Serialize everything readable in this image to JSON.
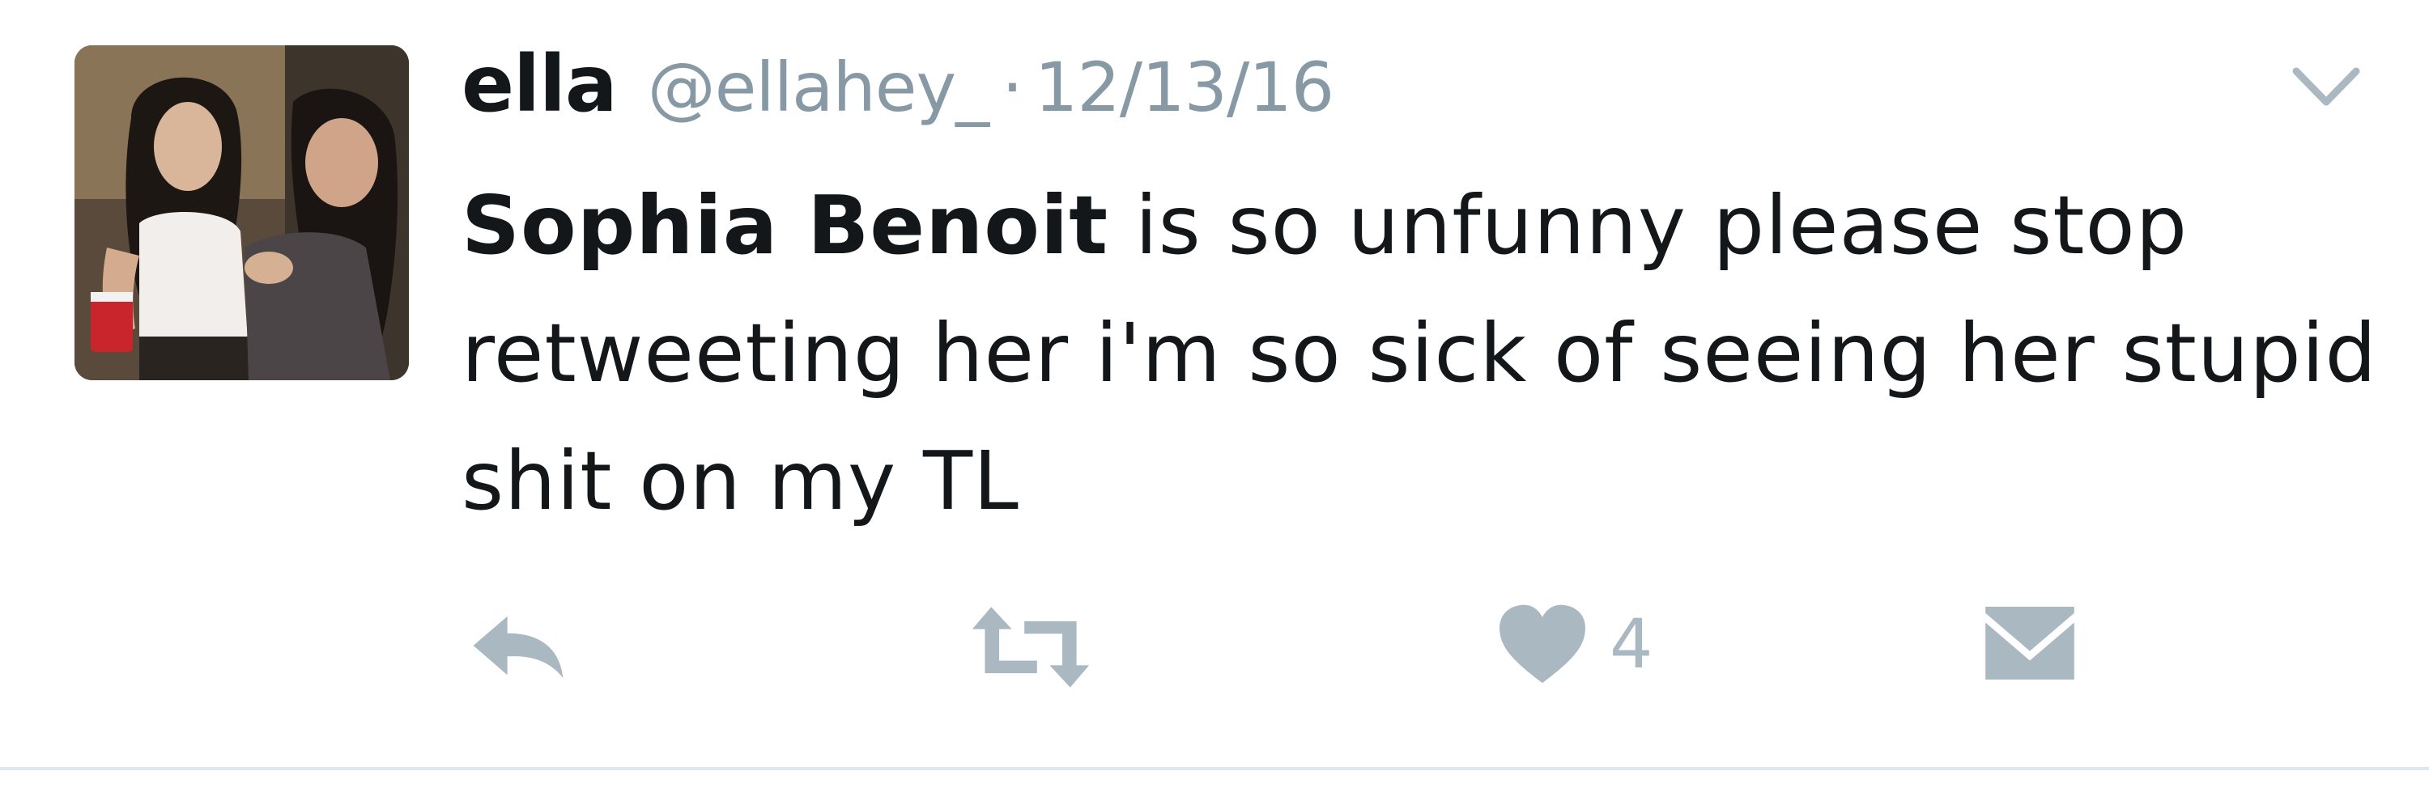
{
  "tweet": {
    "author": {
      "display_name": "ella",
      "handle": "@ellahey_",
      "avatar_icon": "profile-photo"
    },
    "separator": "·",
    "timestamp": "12/13/16",
    "text": {
      "mention": "Sophia Benoit",
      "body": " is so unfunny please stop retweeting her i'm so sick of seeing her stupid shit on my TL"
    },
    "menu_icon": "chevron-down-icon",
    "actions": {
      "reply_icon": "reply-icon",
      "retweet_icon": "retweet-icon",
      "like_icon": "heart-icon",
      "like_count": "4",
      "dm_icon": "envelope-icon"
    }
  },
  "colors": {
    "text_primary": "#14171a",
    "text_secondary": "#8899a6",
    "action_gray": "#aab8c2",
    "divider": "#e1e8ed"
  }
}
